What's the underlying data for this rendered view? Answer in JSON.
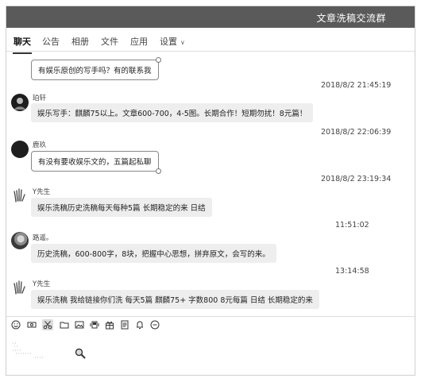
{
  "window": {
    "title": "文章洗稿交流群"
  },
  "tabs": [
    {
      "label": "聊天"
    },
    {
      "label": "公告"
    },
    {
      "label": "相册"
    },
    {
      "label": "文件"
    },
    {
      "label": "应用"
    },
    {
      "label": "设置"
    }
  ],
  "messages": [
    {
      "text": "有娱乐原创的写手吗？有的联系我"
    },
    {
      "time": "2018/8/2 21:45:19",
      "sender": "珀轩",
      "text": "娱乐写手：麒麟75以上。文章600-700，4-5图。长期合作！短期勿扰！8元篇！"
    },
    {
      "time": "2018/8/2 22:06:39",
      "sender": "鹿玖",
      "text": "有没有要收娱乐文的，五篇起私聊"
    },
    {
      "time": "2018/8/2 23:19:34",
      "sender": "Y先生",
      "text": "娱乐洗稿历史洗稿每天每种5篇  长期稳定的来 日结"
    },
    {
      "time": "11:51:02",
      "sender": "路遥。",
      "text": "历史洗稿，600-800字，8块，把握中心思想，拼弃原文，会写的来。"
    },
    {
      "time": "13:14:58",
      "sender": "Y先生",
      "text": "娱乐洗稿  我给链接你们洗  每天5篇  麒麟75+  字数800  8元每篇 日结 长期稳定的来"
    }
  ],
  "toolbar": {
    "icons": [
      "smile-icon",
      "screen-record-icon",
      "scissors-icon",
      "folder-icon",
      "image-icon",
      "shake-icon",
      "gift-icon",
      "document-icon",
      "bell-icon",
      "more-icon"
    ]
  }
}
